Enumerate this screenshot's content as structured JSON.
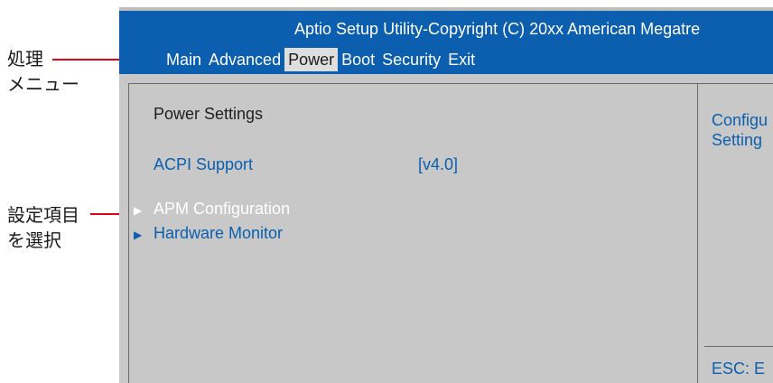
{
  "header": {
    "title": "Aptio Setup Utility-Copyright (C) 20xx American Megatre",
    "menu": [
      {
        "label": "Main",
        "selected": false
      },
      {
        "label": "Advanced",
        "selected": false
      },
      {
        "label": "Power",
        "selected": true
      },
      {
        "label": "Boot",
        "selected": false
      },
      {
        "label": "Security",
        "selected": false
      },
      {
        "label": "Exit",
        "selected": false
      }
    ]
  },
  "content": {
    "section_title": "Power  Settings",
    "items": [
      {
        "label": "ACPI Support",
        "value": "[v4.0]",
        "submenu": false,
        "highlighted": false
      },
      {
        "label": "APM Configuration",
        "submenu": true,
        "highlighted": true
      },
      {
        "label": "Hardware Monitor",
        "submenu": true,
        "highlighted": false
      }
    ],
    "submenu_arrow": "▶"
  },
  "help_panel": {
    "line1": "Configu",
    "line2": "Setting",
    "footer": "ESC: E"
  },
  "annotations": {
    "menu_label_line1": "処理",
    "menu_label_line2": "メニュー",
    "select_label_line1": "設定項目",
    "select_label_line2": "を選択"
  },
  "colors": {
    "header_bg": "#0b5fae",
    "body_bg": "#c8c8c8",
    "accent_text": "#0b5fae",
    "callout": "#e3001b"
  }
}
